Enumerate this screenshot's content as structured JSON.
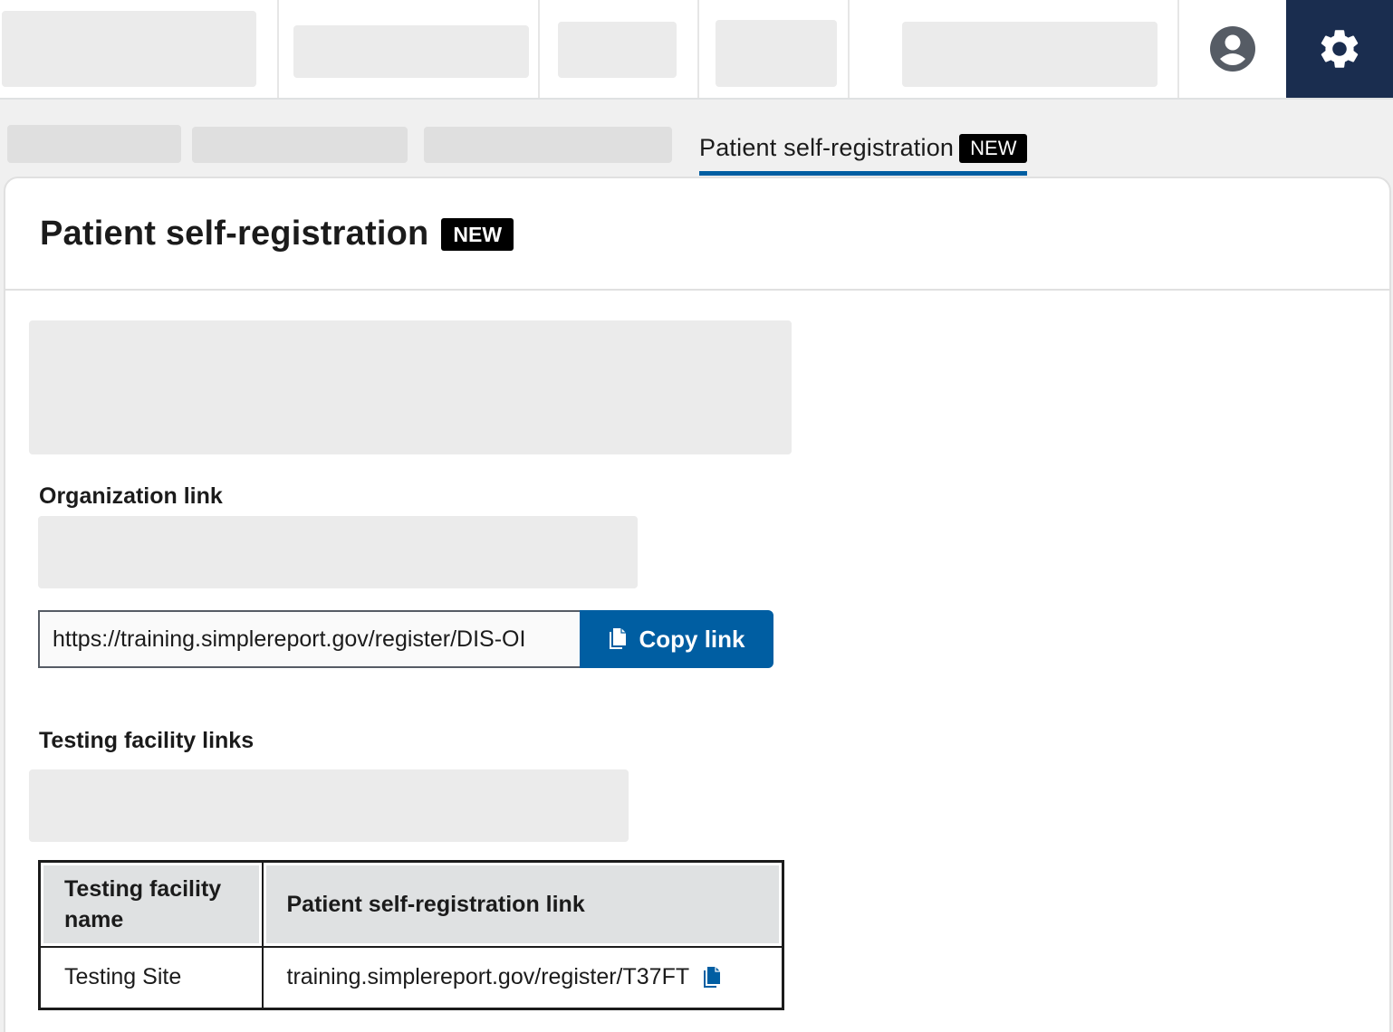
{
  "colors": {
    "primary": "#005ea2",
    "navy": "#1a2d4f",
    "badge_bg": "#000000",
    "placeholder": "#ebebeb"
  },
  "header": {
    "user_icon": "user-circle-icon",
    "settings_icon": "gear-icon"
  },
  "tabs": {
    "active": {
      "label": "Patient self-registration",
      "badge": "NEW"
    }
  },
  "page": {
    "title": "Patient self-registration",
    "title_badge": "NEW"
  },
  "organization": {
    "heading": "Organization link",
    "url_value": "https://training.simplereport.gov/register/DIS-OI",
    "copy_button_label": "Copy link",
    "copy_icon": "copy-icon"
  },
  "facilities": {
    "heading": "Testing facility links",
    "table": {
      "headers": [
        "Testing facility name",
        "Patient self-registration link"
      ],
      "rows": [
        {
          "name": "Testing Site",
          "link": "training.simplereport.gov/register/T37FT",
          "copy_icon": "copy-icon"
        }
      ]
    }
  }
}
